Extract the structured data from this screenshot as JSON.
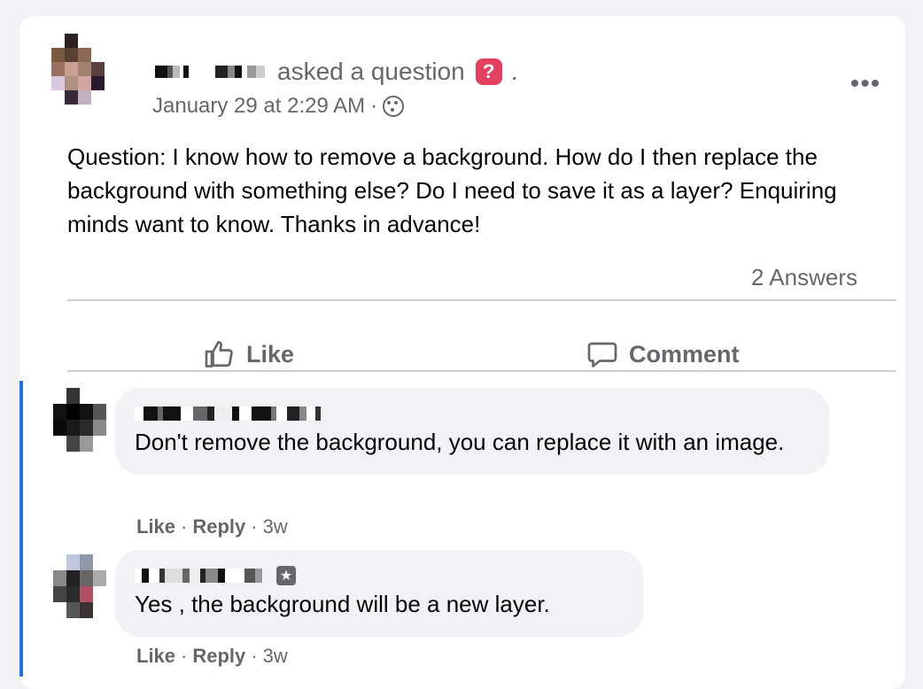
{
  "post": {
    "asked_text": "asked a question",
    "question_badge": "?",
    "trailing_dot": ".",
    "timestamp": "January 29 at 2:29 AM",
    "meta_separator": "·",
    "more_label": "•••",
    "question_text": "Question: I know how to remove a background. How do I then replace the background with something else? Do I need to save it as a layer? Enquiring minds want to know. Thanks in advance!",
    "answers_count": "2 Answers"
  },
  "actions": {
    "like_label": "Like",
    "comment_label": "Comment"
  },
  "comments": [
    {
      "text": "Don't remove the background, you can replace it with an image.",
      "like_label": "Like",
      "reply_label": "Reply",
      "age": "3w",
      "sep": "·"
    },
    {
      "text": "Yes , the background will be a new layer.",
      "like_label": "Like",
      "reply_label": "Reply",
      "age": "3w",
      "sep": "·"
    }
  ],
  "colors": {
    "accent": "#1b74e4",
    "question_badge": "#e4405f",
    "secondary_text": "#65676b",
    "comment_bg": "#f0f2f5"
  },
  "icons": {
    "question": "question-badge-icon",
    "audience": "globe-icon",
    "like": "thumbs-up-icon",
    "comment": "speech-bubble-icon",
    "more": "more-options-icon",
    "comment_badge": "author-badge-icon"
  }
}
